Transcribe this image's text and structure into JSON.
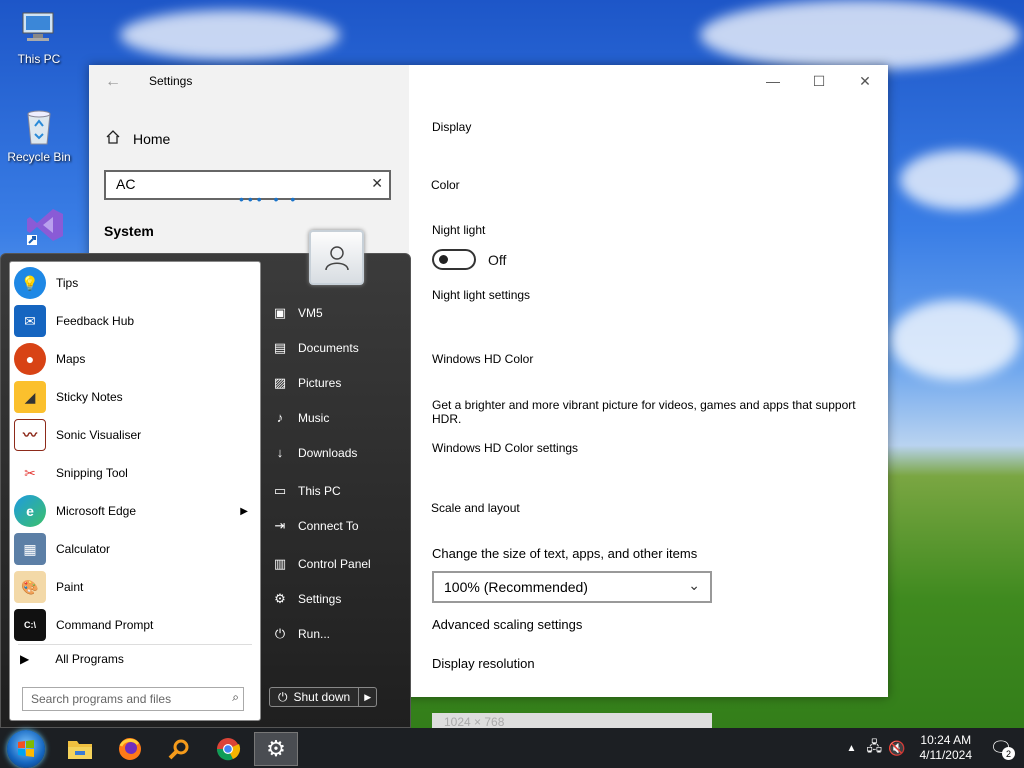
{
  "desktop": {
    "icons": [
      {
        "label": "This PC"
      },
      {
        "label": "Recycle Bin"
      }
    ]
  },
  "settings": {
    "title": "Settings",
    "home_label": "Home",
    "search_value": "AC",
    "section_label": "System",
    "page_title": "Display",
    "color_heading": "Color",
    "night_light_label": "Night light",
    "night_light_state": "Off",
    "night_light_link": "Night light settings",
    "hdr_heading": "Windows HD Color",
    "hdr_desc": "Get a brighter and more vibrant picture for videos, games and apps that support HDR.",
    "hdr_link": "Windows HD Color settings",
    "scale_heading": "Scale and layout",
    "scale_label": "Change the size of text, apps, and other items",
    "scale_value": "100% (Recommended)",
    "scale_link": "Advanced scaling settings",
    "resolution_label": "Display resolution",
    "resolution_value": "1024 × 768"
  },
  "startmenu": {
    "programs": [
      {
        "label": "Tips",
        "icon": "tips-icon",
        "color": "#1e88e5"
      },
      {
        "label": "Feedback Hub",
        "icon": "feedback-hub-icon",
        "color": "#1565c0"
      },
      {
        "label": "Maps",
        "icon": "maps-icon",
        "color": "#d84315"
      },
      {
        "label": "Sticky Notes",
        "icon": "sticky-notes-icon",
        "color": "#fbc02d"
      },
      {
        "label": "Sonic Visualiser",
        "icon": "sonic-visualiser-icon",
        "color": "#8d2a1a"
      },
      {
        "label": "Snipping Tool",
        "icon": "snipping-tool-icon",
        "color": "#e53935"
      },
      {
        "label": "Microsoft Edge",
        "icon": "edge-icon",
        "color": "#0f8a6a"
      },
      {
        "label": "Calculator",
        "icon": "calculator-icon",
        "color": "#5c7fa6"
      },
      {
        "label": "Paint",
        "icon": "paint-icon",
        "color": "#f0a030"
      },
      {
        "label": "Command Prompt",
        "icon": "command-prompt-icon",
        "color": "#111111"
      }
    ],
    "all_programs": "All Programs",
    "search_placeholder": "Search programs and files",
    "places": [
      {
        "label": "VM5",
        "icon": "user-folder-icon"
      },
      {
        "label": "Documents",
        "icon": "documents-icon"
      },
      {
        "label": "Pictures",
        "icon": "pictures-icon"
      },
      {
        "label": "Music",
        "icon": "music-icon"
      },
      {
        "label": "Downloads",
        "icon": "downloads-icon"
      },
      {
        "label": "This PC",
        "icon": "computer-icon"
      },
      {
        "label": "Connect To",
        "icon": "connect-icon"
      },
      {
        "label": "Control Panel",
        "icon": "control-panel-icon"
      },
      {
        "label": "Settings",
        "icon": "gear-icon"
      },
      {
        "label": "Run...",
        "icon": "run-icon"
      }
    ],
    "shutdown_label": "Shut down"
  },
  "taskbar": {
    "time": "10:24 AM",
    "date": "4/11/2024",
    "notification_count": "2"
  }
}
